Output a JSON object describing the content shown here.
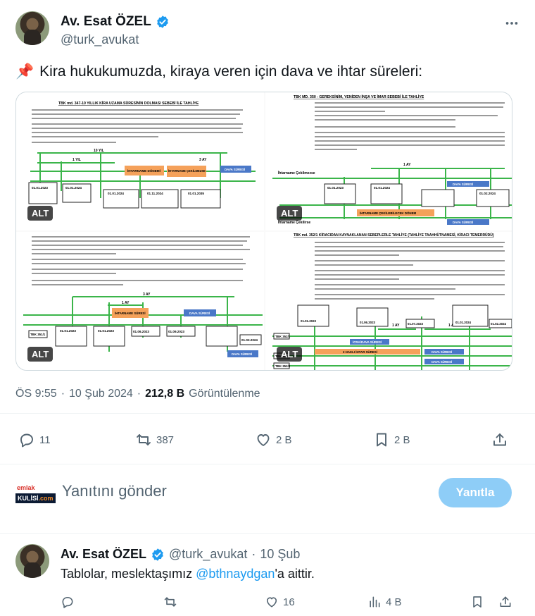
{
  "tweet": {
    "display_name": "Av. Esat ÖZEL",
    "handle": "@turk_avukat",
    "more_icon": "more-horizontal-icon",
    "text_emoji": "📌",
    "text": "Kira hukukumuzda, kiraya veren için dava ve ihtar süreleri:",
    "media_alt_label": "ALT",
    "media": {
      "q1": {
        "heading": "TBK md. 347-10 YILLIK KİRA UZAMA SÜRESİNİN DOLMASI SEBEBİ İLE TAHLİYE",
        "labels": [
          "10 YIL",
          "1 YIL",
          "3 AY",
          "01.01.2023",
          "01.01.2024",
          "01.01.2024",
          "01.11.2024",
          "01.01.2035",
          "İHTARNAME DÖNEMİ",
          "İHTARNAME ÇEKİLMEZSE",
          "DAVA SÜRESİ"
        ]
      },
      "q2": {
        "heading": "TBK MD. 350 - GEREKSİNİM, YENİDEN İNŞA VE İMAR SEBEBİ İLE TAHLİYE",
        "labels": [
          "1 AY",
          "01.01.2023",
          "01.01.2024",
          "01.02.2024",
          "İhtarname Çekilmezse",
          "DAVA SÜRESİ",
          "İHTARNAME ÇEKİLEBİLECEK DÖNEM",
          "İhtarname Çekilirse",
          "DAVA SÜRESİ"
        ]
      },
      "q3": {
        "heading": "",
        "labels": [
          "3 AY",
          "1 AY",
          "TBK 351/1",
          "01.01.2023",
          "01.01.2023",
          "01.06.2023",
          "01.09.2023",
          "01.02.2024",
          "İHTARNAME SÜRESİ",
          "DAVA SÜRESİ",
          "DAVA SÜRESİ"
        ]
      },
      "q4": {
        "heading": "TBK md. 352/1 KİRACIDAN KAYNAKLANAN SEBEPLERLE TAHLİYE (TAHLİYE TAAHHÜTNAMESİ, KİRACI TEMERRÜDÜ)",
        "labels": [
          "1 AY",
          "1 AY",
          "01.01.2023",
          "01.06.2023",
          "01.07.2023",
          "01.01.2024",
          "01.02.2024",
          "İCRA/DAVA SÜRESİ",
          "2 HAKLI İHTAR SÜRESİ",
          "DAVA SÜRESİ",
          "DAVA SÜRESİ",
          "TBK 352/1",
          "TBK 352/2",
          "TBK 352/3"
        ]
      }
    },
    "time": "ÖS 9:55",
    "date": "10 Şub 2024",
    "views_count": "212,8 B",
    "views_label": "Görüntülenme",
    "actions": {
      "reply_count": "11",
      "retweet_count": "387",
      "like_count": "2 B",
      "bookmark_count": "2 B"
    }
  },
  "reply_box": {
    "logo_top": "emlak",
    "logo_bottom": "KULİSİ",
    "logo_suffix": ".com",
    "placeholder": "Yanıtını gönder",
    "button": "Yanıtla"
  },
  "reply_tweet": {
    "display_name": "Av. Esat ÖZEL",
    "handle": "@turk_avukat",
    "dot": "·",
    "date": "10 Şub",
    "text_before": "Tablolar, meslektaşımız ",
    "mention": "@bthnaydgan",
    "text_after": "'a aittir.",
    "actions": {
      "reply_count": "",
      "retweet_count": "",
      "like_count": "16",
      "views_count": "4 B"
    }
  },
  "colors": {
    "accent": "#1d9bf0",
    "green_line": "#3bb54a",
    "orange_bar": "#f5a15a",
    "blue_bar": "#4a78c8",
    "reply_button": "#8ecdf7"
  }
}
